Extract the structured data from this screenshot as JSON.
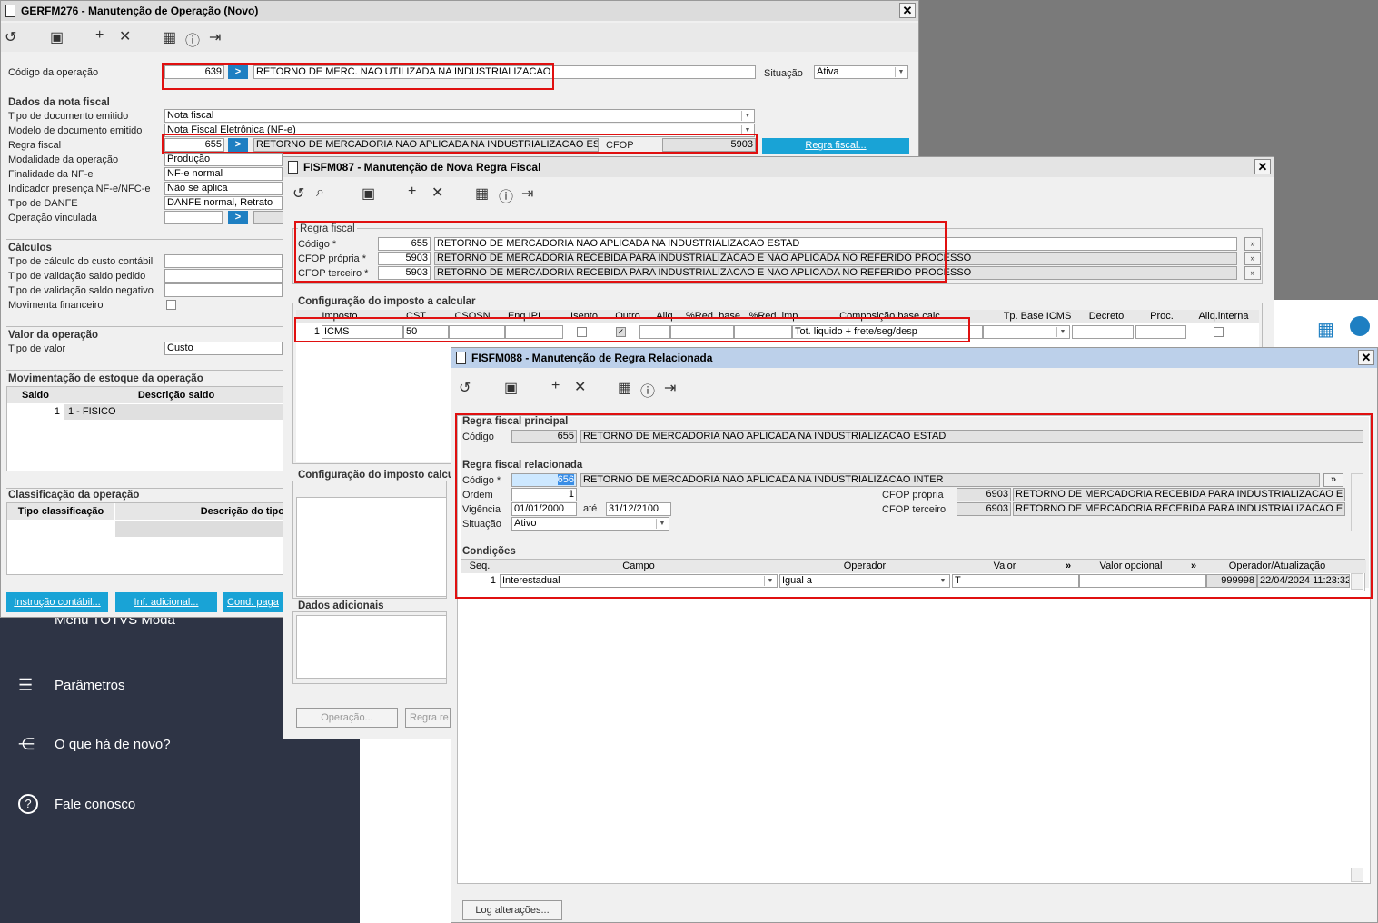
{
  "bg": {
    "nav": {
      "partial_top": "Menu TOTVS Moda",
      "params": "Parâmetros",
      "news": "O que há de novo?",
      "contact": "Fale conosco"
    }
  },
  "w1": {
    "title": "GERFM276 - Manutenção de Operação (Novo)",
    "codigo_label": "Código da operação",
    "codigo": "639",
    "codigo_desc": "RETORNO DE MERC. NAO UTILIZADA NA INDUSTRIALIZACAO",
    "situacao_label": "Situação",
    "situacao": "Ativa",
    "dados_nf": "Dados da nota fiscal",
    "tipo_doc_label": "Tipo de documento emitido",
    "tipo_doc": "Nota fiscal",
    "modelo_label": "Modelo de documento emitido",
    "modelo": "Nota Fiscal Eletrônica (NF-e)",
    "regra_label": "Regra fiscal",
    "regra": "655",
    "regra_desc": "RETORNO DE MERCADORIA NAO APLICADA NA INDUSTRIALIZACAO ESTAD",
    "cfop_label": "CFOP",
    "cfop": "5903",
    "regra_btn": "Regra fiscal...",
    "modalidade_label": "Modalidade da operação",
    "modalidade": "Produção",
    "finalidade_label": "Finalidade da NF-e",
    "finalidade": "NF-e normal",
    "indicador_label": "Indicador presença NF-e/NFC-e",
    "indicador": "Não se aplica",
    "danfe_label": "Tipo de DANFE",
    "danfe": "DANFE normal, Retrato",
    "vinculada_label": "Operação vinculada",
    "calculos": "Cálculos",
    "calc1": "Tipo de cálculo do custo contábil",
    "calc2": "Tipo de validação saldo pedido",
    "calc3": "Tipo de validação saldo negativo",
    "calc4": "Movimenta financeiro",
    "valor_op": "Valor da operação",
    "tipo_valor_label": "Tipo de valor",
    "tipo_valor": "Custo",
    "mov_estoque": "Movimentação de estoque da operação",
    "col_saldo": "Saldo",
    "col_desc_saldo": "Descrição saldo",
    "row_saldo": "1",
    "row_desc": "1 - FISICO",
    "classif": "Classificação da operação",
    "col_tipo_classif": "Tipo classificação",
    "col_desc_tipo": "Descrição do tipo",
    "btn_instrucao": "Instrução contábil...",
    "btn_inf": "Inf. adicional...",
    "btn_cond": "Cond. paga"
  },
  "w2": {
    "title": "FISFM087 - Manutenção de Nova Regra Fiscal",
    "regra_fiscal": "Regra fiscal",
    "codigo_label": "Código *",
    "codigo": "655",
    "codigo_desc": "RETORNO DE MERCADORIA NAO APLICADA NA INDUSTRIALIZACAO ESTAD",
    "cfop_propria_label": "CFOP própria *",
    "cfop_propria": "5903",
    "cfop_propria_desc": "RETORNO DE MERCADORIA RECEBIDA PARA INDUSTRIALIZACAO E NAO APLICADA NO REFERIDO PROCESSO",
    "cfop_terceiro_label": "CFOP terceiro *",
    "cfop_terceiro": "5903",
    "cfop_terceiro_desc": "RETORNO DE MERCADORIA RECEBIDA PARA INDUSTRIALIZACAO E NAO APLICADA NO REFERIDO PROCESSO",
    "config": "Configuração do imposto a calcular",
    "cols": [
      "Imposto",
      "CST",
      "CSOSN",
      "Enq.IPI",
      "Isento",
      "Outro",
      "Aliq.",
      "%Red. base",
      "%Red. imp.",
      "Composição base calc.",
      "Tp. Base ICMS",
      "Decreto",
      "Proc.",
      "Aliq.interna"
    ],
    "row_num": "1",
    "row_imposto": "ICMS",
    "row_cst": "50",
    "row_comp": "Tot. liquido + frete/seg/desp",
    "config2": "Configuração do imposto calcu",
    "dados_adic": "Dados adicionais",
    "btn_operacao": "Operação...",
    "btn_regra": "Regra re"
  },
  "w3": {
    "title": "FISFM088 - Manutenção de Regra Relacionada",
    "principal": "Regra fiscal principal",
    "codigo_label": "Código",
    "codigo": "655",
    "codigo_desc": "RETORNO DE MERCADORIA NAO APLICADA NA INDUSTRIALIZACAO ESTAD",
    "relacionada": "Regra fiscal relacionada",
    "rel_codigo_label": "Código *",
    "rel_codigo": "656",
    "rel_codigo_desc": "RETORNO DE MERCADORIA NAO APLICADA NA INDUSTRIALIZACAO INTER",
    "ordem_label": "Ordem",
    "ordem": "1",
    "vigencia_label": "Vigência",
    "vig_ini": "01/01/2000",
    "ate": "até",
    "vig_fim": "31/12/2100",
    "situacao_label": "Situação",
    "situacao": "Ativo",
    "cfop_propria_label": "CFOP própria",
    "cfop_propria": "6903",
    "cfop_propria_desc": "RETORNO DE MERCADORIA RECEBIDA PARA INDUSTRIALIZACAO E NAO A",
    "cfop_terceiro_label": "CFOP terceiro",
    "cfop_terceiro": "6903",
    "cfop_terceiro_desc": "RETORNO DE MERCADORIA RECEBIDA PARA INDUSTRIALIZACAO E NAO A",
    "condicoes": "Condições",
    "cols": [
      "Seq.",
      "Campo",
      "Operador",
      "Valor",
      "Valor opcional",
      "Operador/Atualização"
    ],
    "row_seq": "1",
    "row_campo": "Interestadual",
    "row_operador": "Igual a",
    "row_valor": "T",
    "row_user": "999998",
    "row_date": "22/04/2024 11:23:32",
    "btn_log": "Log alterações..."
  }
}
